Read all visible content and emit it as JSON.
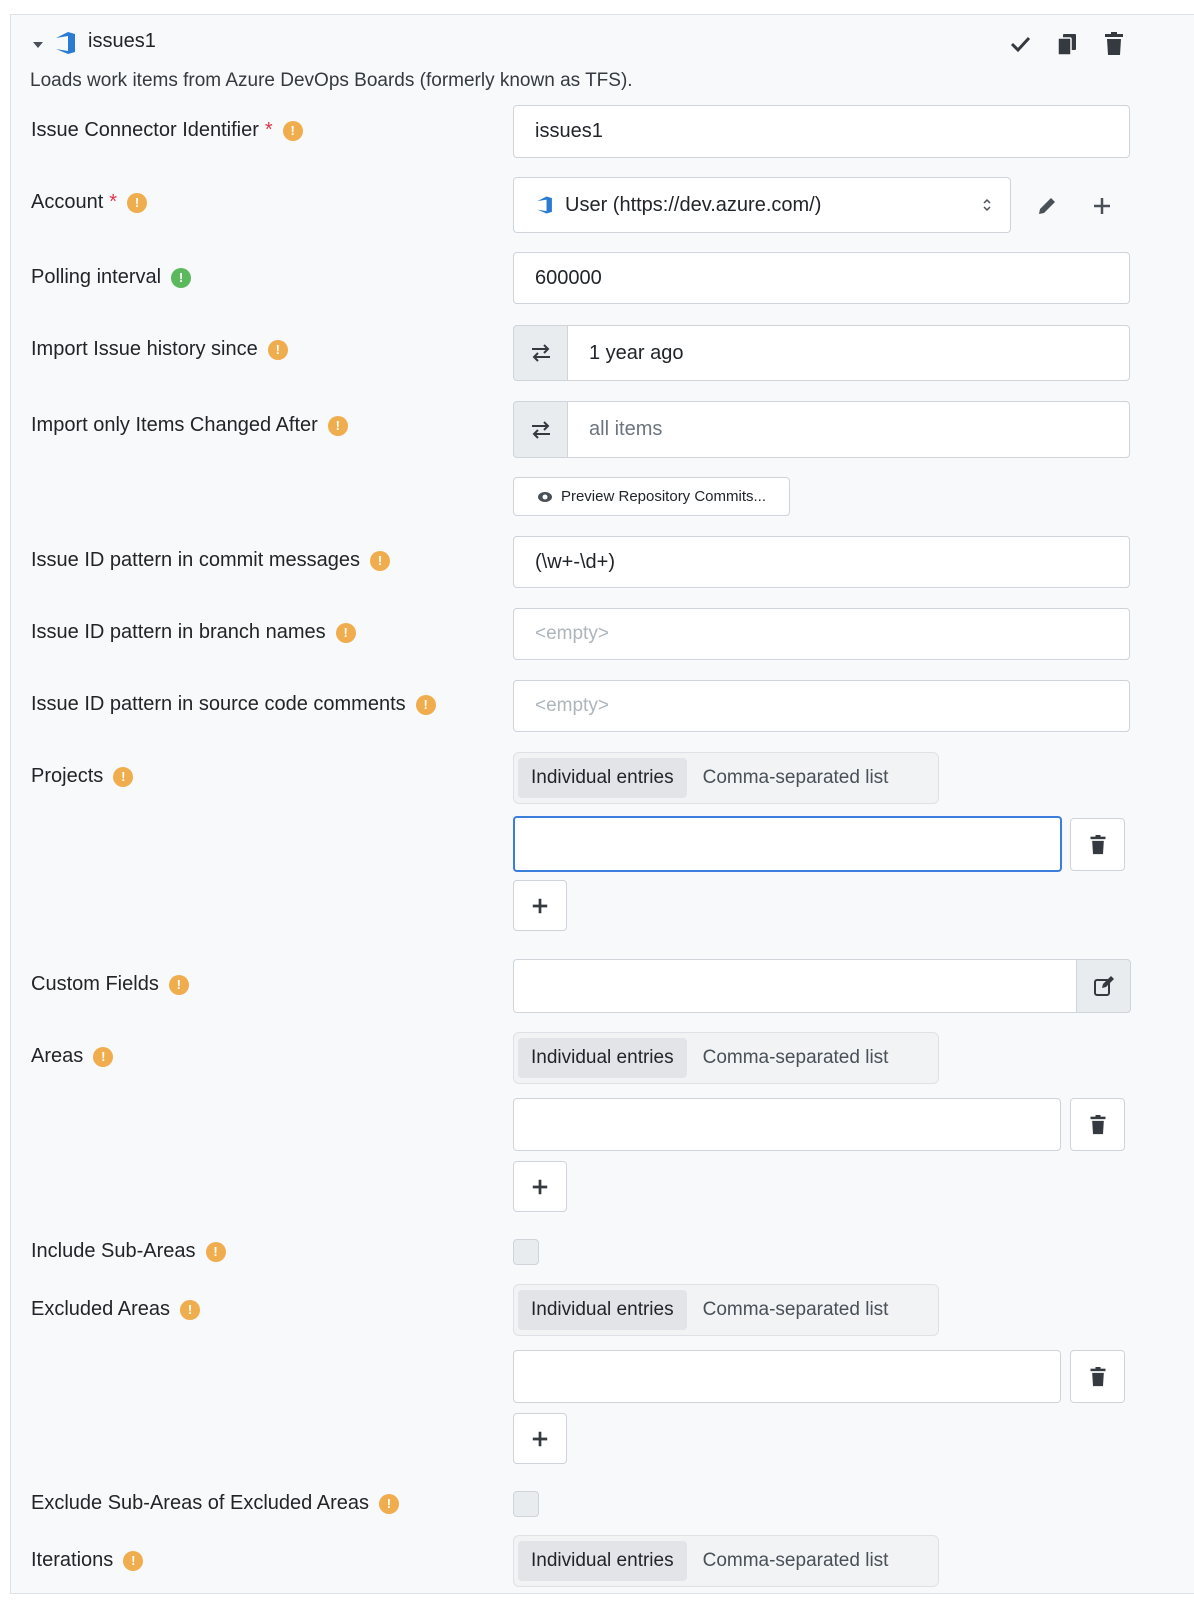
{
  "header": {
    "title": "issues1",
    "description": "Loads work items from Azure DevOps Boards (formerly known as TFS)."
  },
  "fields": {
    "identifier": {
      "label": "Issue Connector Identifier",
      "required": "*",
      "value": "issues1"
    },
    "account": {
      "label": "Account",
      "required": "*",
      "value": "User (https://dev.azure.com/)"
    },
    "polling": {
      "label": "Polling interval",
      "value": "600000"
    },
    "history": {
      "label": "Import Issue history since",
      "value": "1 year ago"
    },
    "changed_after": {
      "label": "Import only Items Changed After",
      "placeholder": "all items"
    },
    "preview_button": "Preview Repository Commits...",
    "commit_pattern": {
      "label": "Issue ID pattern in commit messages",
      "value": "(\\w+-\\d+)"
    },
    "branch_pattern": {
      "label": "Issue ID pattern in branch names",
      "placeholder": "<empty>"
    },
    "source_pattern": {
      "label": "Issue ID pattern in source code comments",
      "placeholder": "<empty>"
    },
    "projects": {
      "label": "Projects"
    },
    "custom_fields": {
      "label": "Custom Fields"
    },
    "areas": {
      "label": "Areas"
    },
    "include_sub_areas": {
      "label": "Include Sub-Areas"
    },
    "excluded_areas": {
      "label": "Excluded Areas"
    },
    "exclude_sub_areas": {
      "label": "Exclude Sub-Areas of Excluded Areas"
    },
    "iterations": {
      "label": "Iterations"
    }
  },
  "segment": {
    "individual": "Individual entries",
    "comma": "Comma-separated list"
  },
  "colors": {
    "accent": "#3b7ddd",
    "warning": "#f0ad4e",
    "success": "#5cb85c",
    "required": "#dc3545",
    "azure": "#2a7bd3"
  }
}
